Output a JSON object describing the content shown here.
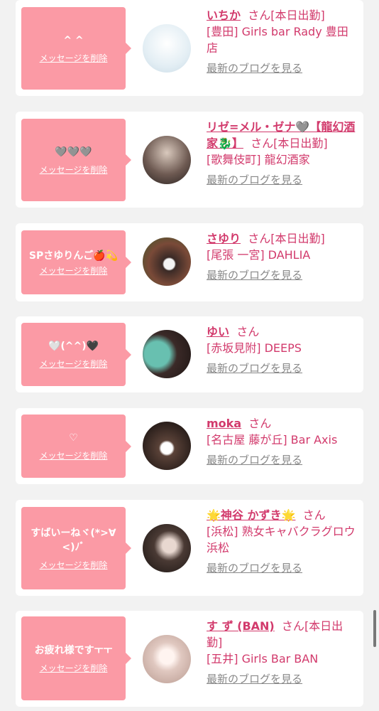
{
  "cards": [
    {
      "message": "^ ^",
      "delete_label": "メッセージを削除",
      "name": "いちか",
      "san": "さん",
      "status": "[本日出勤]",
      "shop": "[豊田] Girls bar Rady 豊田店",
      "blog_label": "最新のブログを見る"
    },
    {
      "message": "🩶🩶🩶",
      "delete_label": "メッセージを削除",
      "name": "リゼ=メル・ゼナ🩶【龍幻酒家🐉】",
      "san": "さん",
      "status": "[本日出勤]",
      "shop": "[歌舞伎町] 龍幻酒家",
      "blog_label": "最新のブログを見る"
    },
    {
      "message": "SPさゆりんご🍎💫",
      "delete_label": "メッセージを削除",
      "name": "さゆり",
      "san": "さん",
      "status": "[本日出勤]",
      "shop": "[尾張 一宮] DAHLIA",
      "blog_label": "最新のブログを見る"
    },
    {
      "message": "🤍(^^)🖤",
      "delete_label": "メッセージを削除",
      "name": "ゆい",
      "san": "さん",
      "status": "",
      "shop": "[赤坂見附] DEEPS",
      "blog_label": "最新のブログを見る"
    },
    {
      "message": "♡",
      "delete_label": "メッセージを削除",
      "name": "moka",
      "san": "さん",
      "status": "",
      "shop": "[名古屋 藤が丘] Bar Axis",
      "blog_label": "最新のブログを見る"
    },
    {
      "message": "すばいーねヾ(*>∀<)ﾉﾞ",
      "delete_label": "メッセージを削除",
      "name": "🌟神谷 かずき🌟",
      "san": "さん",
      "status": "",
      "shop": "[浜松] 熟女キャバクラグロウ 浜松",
      "blog_label": "最新のブログを見る"
    },
    {
      "message": "お疲れ様ですㅜㅜ",
      "delete_label": "メッセージを削除",
      "name": "す ず (BAN)",
      "san": "さん",
      "status": "[本日出勤]",
      "shop": "[五井] Girls Bar BAN",
      "blog_label": "最新のブログを見る"
    }
  ],
  "colors": {
    "bubble": "#fb9aa5",
    "accent": "#d23a6c",
    "muted": "#888888"
  }
}
